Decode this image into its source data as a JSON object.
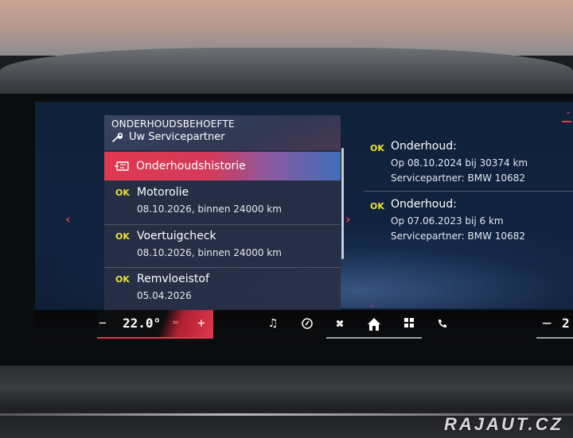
{
  "header": {
    "title": "ONDERHOUDSBEHOEFTE",
    "subtitle": "Uw Servicepartner"
  },
  "selected_item": {
    "label": "Onderhoudshistorie"
  },
  "left_list": [
    {
      "status": "OK",
      "title": "Motorolie",
      "detail": "08.10.2026, binnen 24000 km"
    },
    {
      "status": "OK",
      "title": "Voertuigcheck",
      "detail": "08.10.2026, binnen 24000 km"
    },
    {
      "status": "OK",
      "title": "Remvloeistof",
      "detail": "05.04.2026"
    }
  ],
  "history": [
    {
      "status": "OK",
      "title": "Onderhoud:",
      "line1": "Op 08.10.2024 bij 30374 km",
      "line2": "Servicepartner: BMW 10682"
    },
    {
      "status": "OK",
      "title": "Onderhoud:",
      "line1": "Op 07.06.2023 bij 6 km",
      "line2": "Servicepartner: BMW 10682"
    }
  ],
  "climate": {
    "minus": "−",
    "temperature": "22.0°",
    "plus": "+",
    "right_minus": "−",
    "right_temperature": "2"
  },
  "arrows": {
    "left": "‹",
    "right": "›"
  },
  "watermark": "RAJAUT.CZ",
  "colors": {
    "accent": "#e0394f",
    "ok": "#e8e23a",
    "screen_bg": "#10213a"
  }
}
